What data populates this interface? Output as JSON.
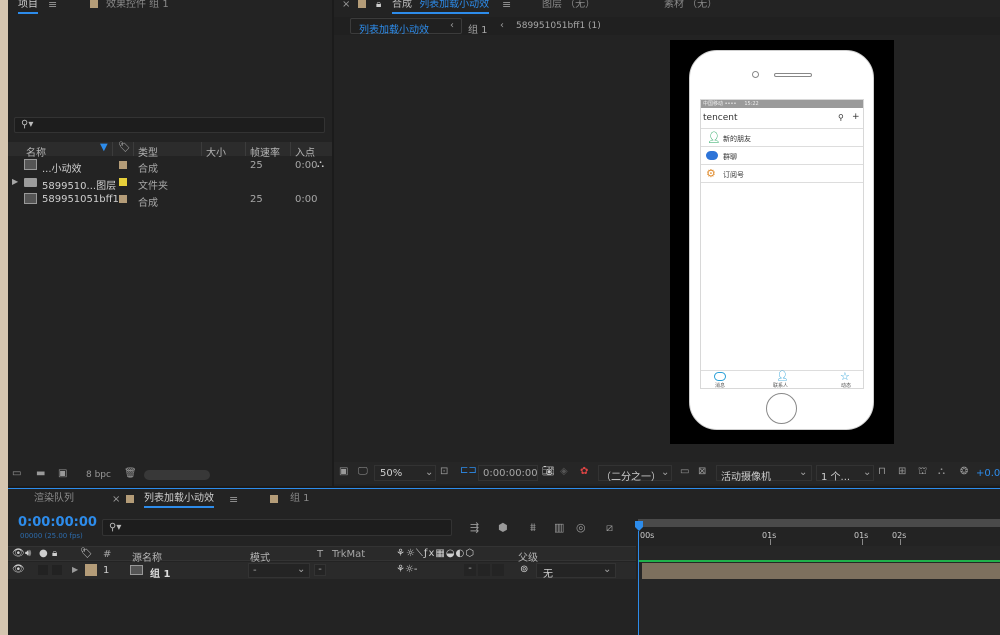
{
  "project_panel": {
    "tab_label": "项目",
    "effects_tab_label": "效果控件 组 1",
    "columns": [
      "名称",
      "类型",
      "大小",
      "帧速率",
      "入点"
    ],
    "items": [
      {
        "name": "...小动效",
        "type": "合成",
        "fps": "25",
        "in": "0:00",
        "kind": "comp",
        "color": "#b49c78"
      },
      {
        "name": "5899510...图层",
        "type": "文件夹",
        "fps": "",
        "in": "",
        "kind": "folder",
        "color": "#e6cf3a"
      },
      {
        "name": "589951051bff1",
        "type": "合成",
        "fps": "25",
        "in": "0:00",
        "kind": "comp",
        "color": "#b49c78"
      }
    ],
    "bpc_label": "8 bpc"
  },
  "comp_panel": {
    "tab_prefix": "合成",
    "tab_name": "列表加载小动效",
    "layer_tab": "图层 （无）",
    "footage_tab": "素材 （无）",
    "breadcrumbs": [
      "列表加载小动效",
      "组 1",
      "589951051bff1 (1)"
    ],
    "zoom": "50%",
    "timecode": "0:00:00:00",
    "resolution": "（二分之一）",
    "camera": "活动摄像机",
    "views": "1 个...",
    "exposure": "+0.0"
  },
  "phone_ui": {
    "status": "中国移动 ••••     15:22     ",
    "brand": "tencent",
    "list": [
      {
        "label": "新的朋友",
        "color": "#1ea35a"
      },
      {
        "label": "群聊",
        "color": "#2d74d8"
      },
      {
        "label": "订阅号",
        "color": "#e08a2a"
      }
    ],
    "bottom_tabs": [
      "消息",
      "联系人",
      "动态"
    ]
  },
  "timeline": {
    "render_queue_tab": "渲染队列",
    "comp_tab": "列表加载小动效",
    "comp2_tab": "组 1",
    "timecode": "0:00:00:00",
    "timecode_sub": "00000 (25.00 fps)",
    "columns": {
      "index": "#",
      "source": "源名称",
      "mode": "模式",
      "t": "T",
      "trkmat": "TrkMat",
      "parent": "父级"
    },
    "layer": {
      "index": "1",
      "name": "组 1",
      "mode": "-",
      "parent": "无"
    },
    "ruler": [
      "00s",
      "01s",
      "01s",
      "02s"
    ]
  }
}
